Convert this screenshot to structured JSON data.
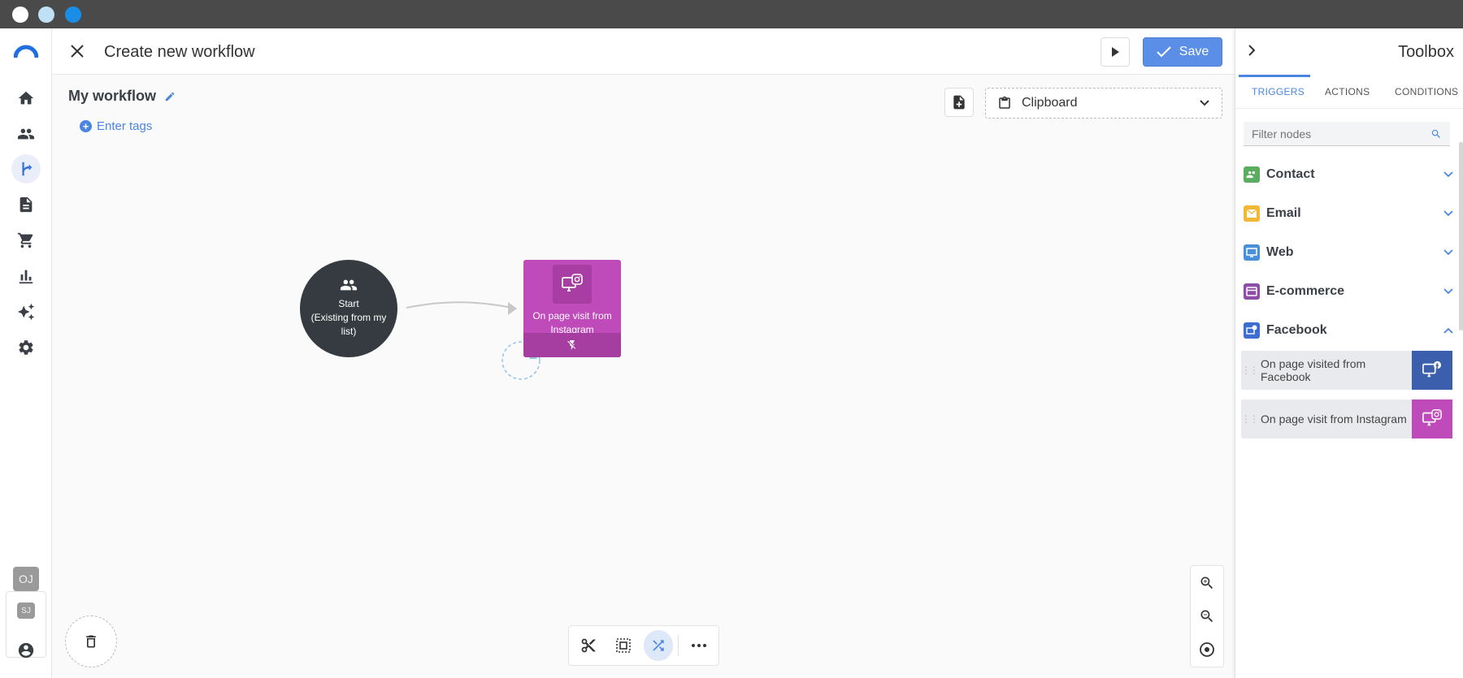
{
  "header": {
    "title": "Create new workflow",
    "save_label": "Save"
  },
  "workflow": {
    "name": "My workflow",
    "tags_label": "Enter tags"
  },
  "clipboard": {
    "label": "Clipboard"
  },
  "nodes": {
    "start": {
      "title": "Start",
      "subtitle": "(Existing from my list)"
    },
    "trigger": {
      "label": "On page visit from Instagram",
      "color": "#bf4ab9"
    }
  },
  "avatars": [
    "OJ",
    "SJ"
  ],
  "toolbox": {
    "title": "Toolbox",
    "tabs": [
      "TRIGGERS",
      "ACTIONS",
      "CONDITIONS"
    ],
    "active_tab": "TRIGGERS",
    "filter_placeholder": "Filter nodes",
    "categories": [
      {
        "name": "Contact",
        "color": "#5aac5e",
        "icon": "contact-icon",
        "expanded": false
      },
      {
        "name": "Email",
        "color": "#f2b733",
        "icon": "email-icon",
        "expanded": false
      },
      {
        "name": "Web",
        "color": "#4a90d9",
        "icon": "web-icon",
        "expanded": false
      },
      {
        "name": "E-commerce",
        "color": "#8e4ea8",
        "icon": "ecommerce-icon",
        "expanded": false
      },
      {
        "name": "Facebook",
        "color": "#3b6ed0",
        "icon": "facebook-icon",
        "expanded": true
      }
    ],
    "facebook_items": [
      {
        "label": "On page visited from Facebook",
        "color": "#3b5ead"
      },
      {
        "label": "On page visit from Instagram",
        "color": "#bf4ab9"
      }
    ]
  },
  "colors": {
    "accent": "#4a86e0",
    "save_button": "#5b8ee6",
    "start_node": "#353b40"
  }
}
